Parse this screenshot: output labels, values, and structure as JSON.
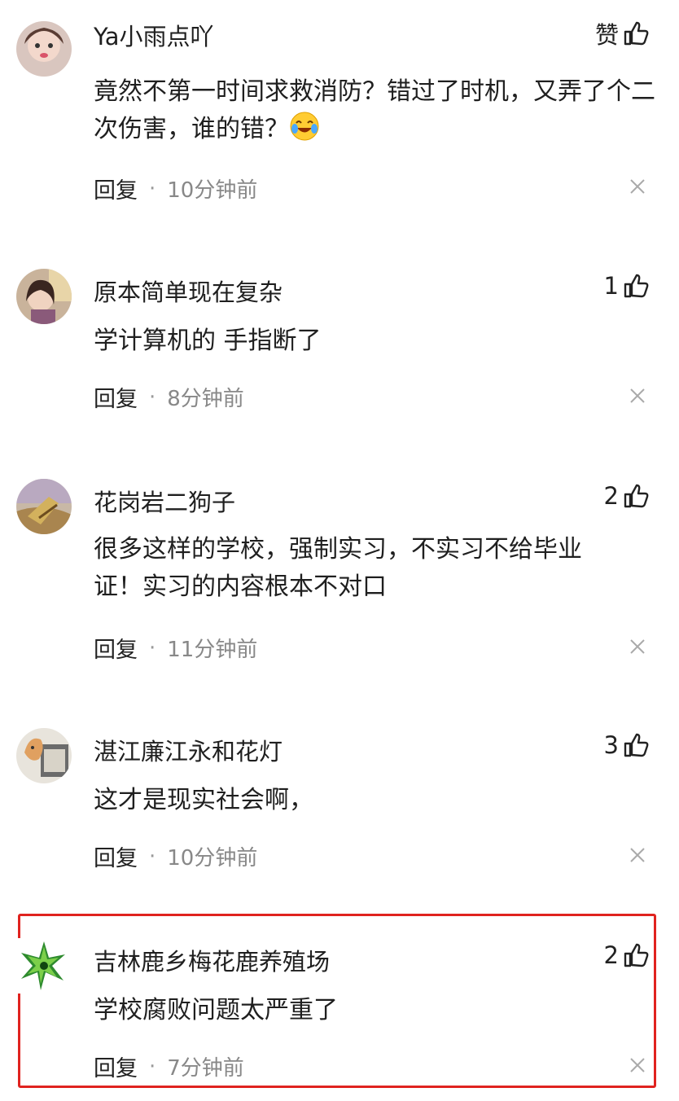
{
  "comments": [
    {
      "username": "Ya小雨点吖",
      "like_label": "赞",
      "text": "竟然不第一时间求救消防？错过了时机，又弄了个二次伤害，谁的错？",
      "emoji": "laughing-crying-emoji",
      "reply_label": "回复",
      "time": "10分钟前"
    },
    {
      "username": "原本简单现在复杂",
      "like_count": "1",
      "text": "学计算机的 手指断了",
      "reply_label": "回复",
      "time": "8分钟前"
    },
    {
      "username": "花岗岩二狗子",
      "like_count": "2",
      "text": "很多这样的学校，强制实习，不实习不给毕业证！实习的内容根本不对口",
      "reply_label": "回复",
      "time": "11分钟前"
    },
    {
      "username": "湛江廉江永和花灯",
      "like_count": "3",
      "text": "这才是现实社会啊，",
      "reply_label": "回复",
      "time": "10分钟前"
    },
    {
      "username": "吉林鹿乡梅花鹿养殖场",
      "like_count": "2",
      "text": "学校腐败问题太严重了",
      "reply_label": "回复",
      "time": "7分钟前"
    }
  ],
  "colors": {
    "highlight_border": "#e0231f",
    "meta_text": "#888888"
  },
  "icons": [
    "thumbs-up-icon",
    "close-icon"
  ]
}
